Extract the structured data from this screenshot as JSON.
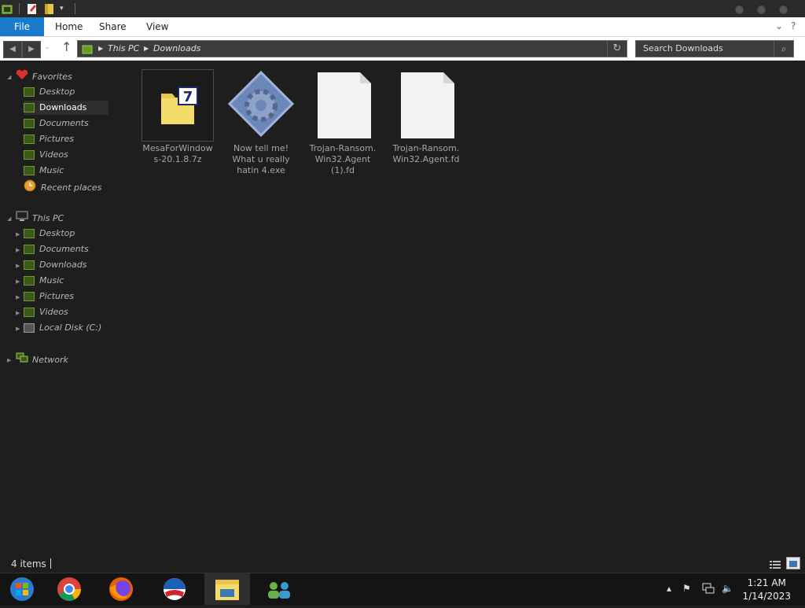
{
  "ribbon": {
    "file_tab": "File",
    "tabs": [
      "Home",
      "Share",
      "View"
    ]
  },
  "address": {
    "crumbs": [
      "This PC",
      "Downloads"
    ]
  },
  "search": {
    "placeholder": "Search Downloads"
  },
  "nav": {
    "favorites": {
      "label": "Favorites",
      "items": [
        "Desktop",
        "Downloads",
        "Documents",
        "Pictures",
        "Videos",
        "Music",
        "Recent places"
      ]
    },
    "this_pc": {
      "label": "This PC",
      "items": [
        "Desktop",
        "Documents",
        "Downloads",
        "Music",
        "Pictures",
        "Videos",
        "Local Disk (C:)"
      ]
    },
    "network": {
      "label": "Network"
    }
  },
  "files": [
    {
      "name": "MesaForWindows-20.1.8.7z",
      "lines": [
        "MesaForWindow",
        "s-20.1.8.7z"
      ],
      "icon": "7zip-archive-icon",
      "selected": true
    },
    {
      "name": "Now tell me! What u really hatin 4.exe",
      "lines": [
        "Now tell me!",
        "What u really",
        "hatin 4.exe"
      ],
      "icon": "exe-gear-icon",
      "selected": false
    },
    {
      "name": "Trojan-Ransom.Win32.Agent (1).fd",
      "lines": [
        "Trojan-Ransom.",
        "Win32.Agent",
        "(1).fd"
      ],
      "icon": "blank-document-icon",
      "selected": false
    },
    {
      "name": "Trojan-Ransom.Win32.Agent.fd",
      "lines": [
        "Trojan-Ransom.",
        "Win32.Agent.fd"
      ],
      "icon": "blank-document-icon",
      "selected": false
    }
  ],
  "status": {
    "items_count": "4 items"
  },
  "taskbar": {
    "apps": [
      "start-icon",
      "chrome-icon",
      "firefox-icon",
      "obama-logo-icon",
      "file-explorer-icon",
      "network-people-icon"
    ],
    "time": "1:21 AM",
    "date": "1/14/2023"
  },
  "colors": {
    "accent": "#1979ca",
    "background": "#1e1e1e",
    "taskbar": "#141414"
  }
}
